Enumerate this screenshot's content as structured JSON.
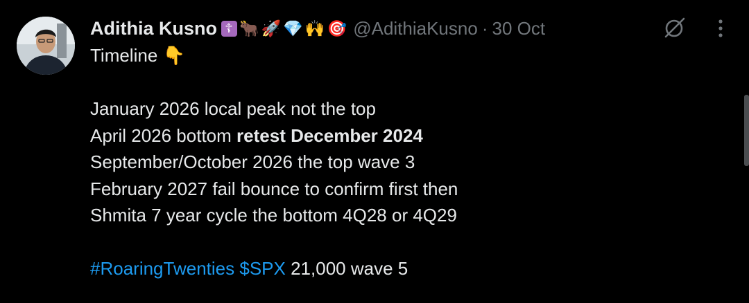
{
  "tweet": {
    "author": {
      "display_name": "Adithia Kusno",
      "badge_emojis": [
        "☦",
        "🐂",
        "🚀",
        "💎",
        "🙌",
        "🎯"
      ],
      "handle": "@AdithiaKusno",
      "separator": "·",
      "date": "30 Oct"
    },
    "text": {
      "intro": "Timeline",
      "intro_emoji": "👇",
      "lines": [
        "January 2026 local peak not the top",
        "April 2026 bottom",
        "retest December 2024",
        "September/October 2026 the top wave 3",
        "February 2027 fail bounce to confirm first then",
        "Shmita 7 year cycle the bottom 4Q28 or 4Q29"
      ],
      "hashtag": "#RoaringTwenties",
      "cashtag": "$SPX",
      "closing": "21,000 wave 5"
    },
    "icons": {
      "grok": "grok-icon",
      "more": "more-vertical-icon"
    }
  },
  "colors": {
    "background": "#000000",
    "text": "#e7e9ea",
    "secondary": "#71767b",
    "link": "#1d9bf0"
  }
}
